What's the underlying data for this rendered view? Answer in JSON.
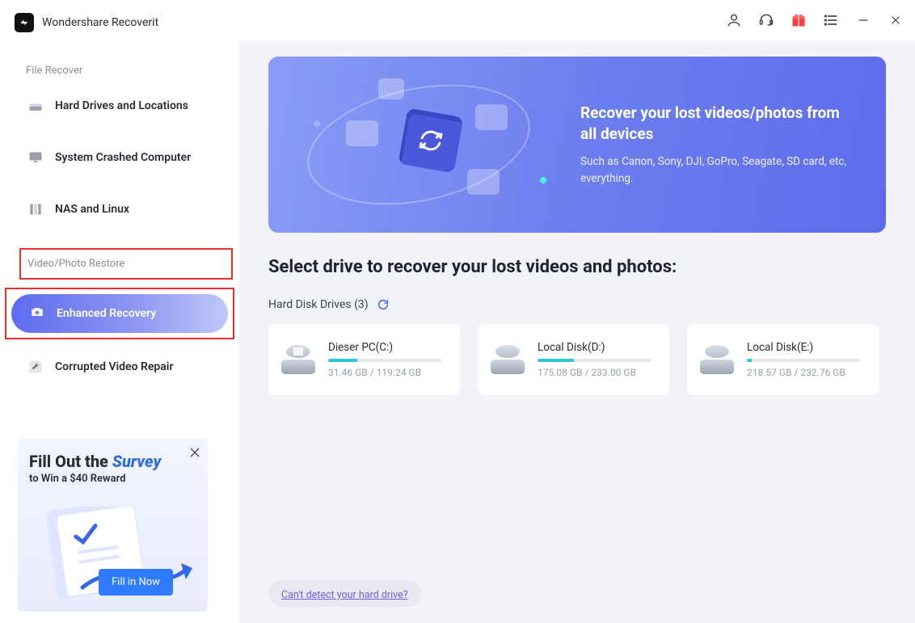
{
  "app": {
    "title": "Wondershare Recoverit"
  },
  "sidebar": {
    "section1_label": "File Recover",
    "items": [
      {
        "label": "Hard Drives and Locations"
      },
      {
        "label": "System Crashed Computer"
      },
      {
        "label": "NAS and Linux"
      }
    ],
    "section2_label": "Video/Photo Restore",
    "enhanced_label": "Enhanced Recovery",
    "repair_label": "Corrupted Video Repair"
  },
  "promo": {
    "line1_a": "Fill Out the ",
    "line1_b": "Survey",
    "line2": "to Win a $40 Reward",
    "button": "Fill in Now"
  },
  "hero": {
    "title": "Recover your lost videos/photos from all devices",
    "subtitle": "Such as Canon, Sony, DJI, GoPro, Seagate, SD card, etc, everything."
  },
  "main": {
    "select_title": "Select drive to recover your lost videos and photos:",
    "drives_label": "Hard Disk Drives (3)",
    "detect_link": "Can't detect your hard drive?"
  },
  "drives": [
    {
      "name": "Dieser PC(C:)",
      "used": "31.46 GB",
      "total": "119.24 GB",
      "fill_pct": 26
    },
    {
      "name": "Local Disk(D:)",
      "used": "175.08 GB",
      "total": "233.00 GB",
      "fill_pct": 32
    },
    {
      "name": "Local Disk(E:)",
      "used": "218.57 GB",
      "total": "232.76 GB",
      "fill_pct": 4
    }
  ]
}
